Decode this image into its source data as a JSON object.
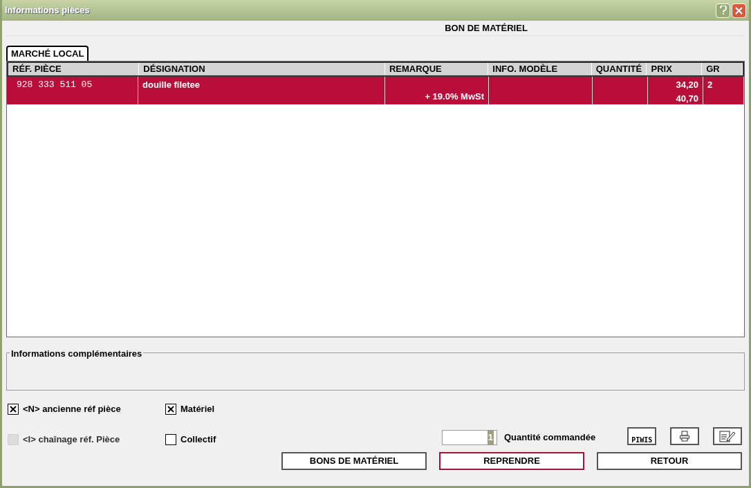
{
  "window": {
    "title": "Informations pièces"
  },
  "header": "BON DE MATÉRIEL",
  "tabs": [
    {
      "label": "MARCHÉ LOCAL",
      "selected": true
    }
  ],
  "table": {
    "columns": [
      "RÉF. PIÈCE",
      "DÉSIGNATION",
      "REMARQUE",
      "INFO. MODÈLE",
      "QUANTITÉ",
      "PRIX",
      "GR"
    ],
    "rows": [
      {
        "selected": true,
        "ref": "928 333 511 05",
        "designation": "douille filetee",
        "remarque": "+ 19.0% MwSt",
        "info_modele": "",
        "quantite": "",
        "prix": [
          "34,20",
          "40,70"
        ],
        "gr": "2"
      }
    ]
  },
  "info_group": {
    "title": "Informations complémentaires"
  },
  "checkboxes": [
    {
      "label": "<N> ancienne réf pièce",
      "checked": true,
      "disabled": false
    },
    {
      "label": "Matériel",
      "checked": true,
      "disabled": false
    },
    {
      "label": "<I> chaînage réf. Pièce",
      "checked": false,
      "disabled": true
    },
    {
      "label": "Collectif",
      "checked": false,
      "disabled": false
    }
  ],
  "quantity": {
    "value": "1",
    "label": "Quantité commandée"
  },
  "piwis_button": {
    "label": "PIWIS"
  },
  "buttons": [
    {
      "label": "BONS DE MATÉRIEL",
      "selected": false
    },
    {
      "label": "REPRENDRE",
      "selected": true
    },
    {
      "label": "RETOUR",
      "selected": false
    }
  ]
}
